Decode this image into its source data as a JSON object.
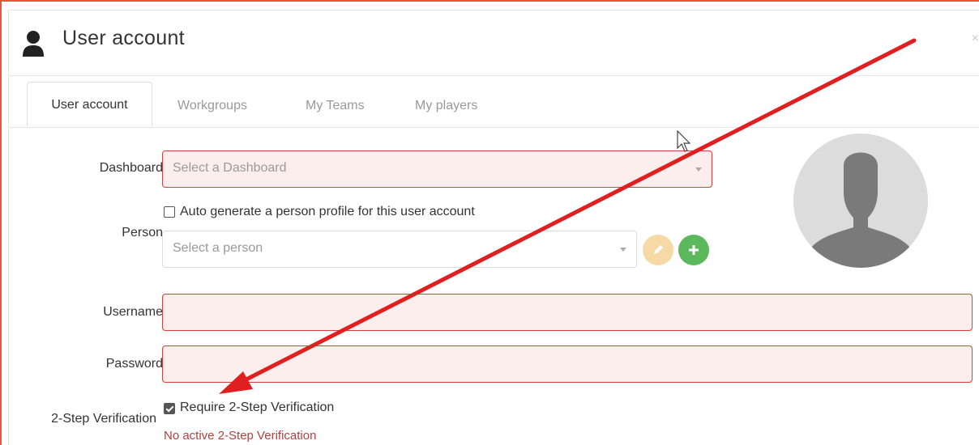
{
  "window": {
    "title": "User account",
    "close_glyph": "×"
  },
  "tabs": [
    {
      "label": "User account",
      "active": true
    },
    {
      "label": "Workgroups",
      "active": false
    },
    {
      "label": "My Teams",
      "active": false
    },
    {
      "label": "My players",
      "active": false
    }
  ],
  "form": {
    "dashboard": {
      "label": "Dashboard",
      "placeholder": "Select a Dashboard"
    },
    "person": {
      "label": "Person",
      "auto_generate_label": "Auto generate a person profile for this user account",
      "auto_generate_checked": false,
      "placeholder": "Select a person"
    },
    "username": {
      "label": "Username",
      "value": ""
    },
    "password": {
      "label": "Password",
      "value": ""
    },
    "two_step": {
      "label": "2-Step Verification",
      "checkbox_label": "Require 2-Step Verification",
      "checked": true,
      "status": "No active 2-Step Verification"
    }
  },
  "icons": {
    "header": "user-icon",
    "edit": "pencil-icon",
    "add": "plus-icon",
    "avatar": "avatar-silhouette"
  },
  "colors": {
    "invalid_border": "#d6403a",
    "invalid_bg": "#fdeeee",
    "edit_button": "#f7d9a6",
    "add_button": "#5cb85c",
    "annotation_arrow": "#e02020",
    "error_text": "#b0413e"
  }
}
